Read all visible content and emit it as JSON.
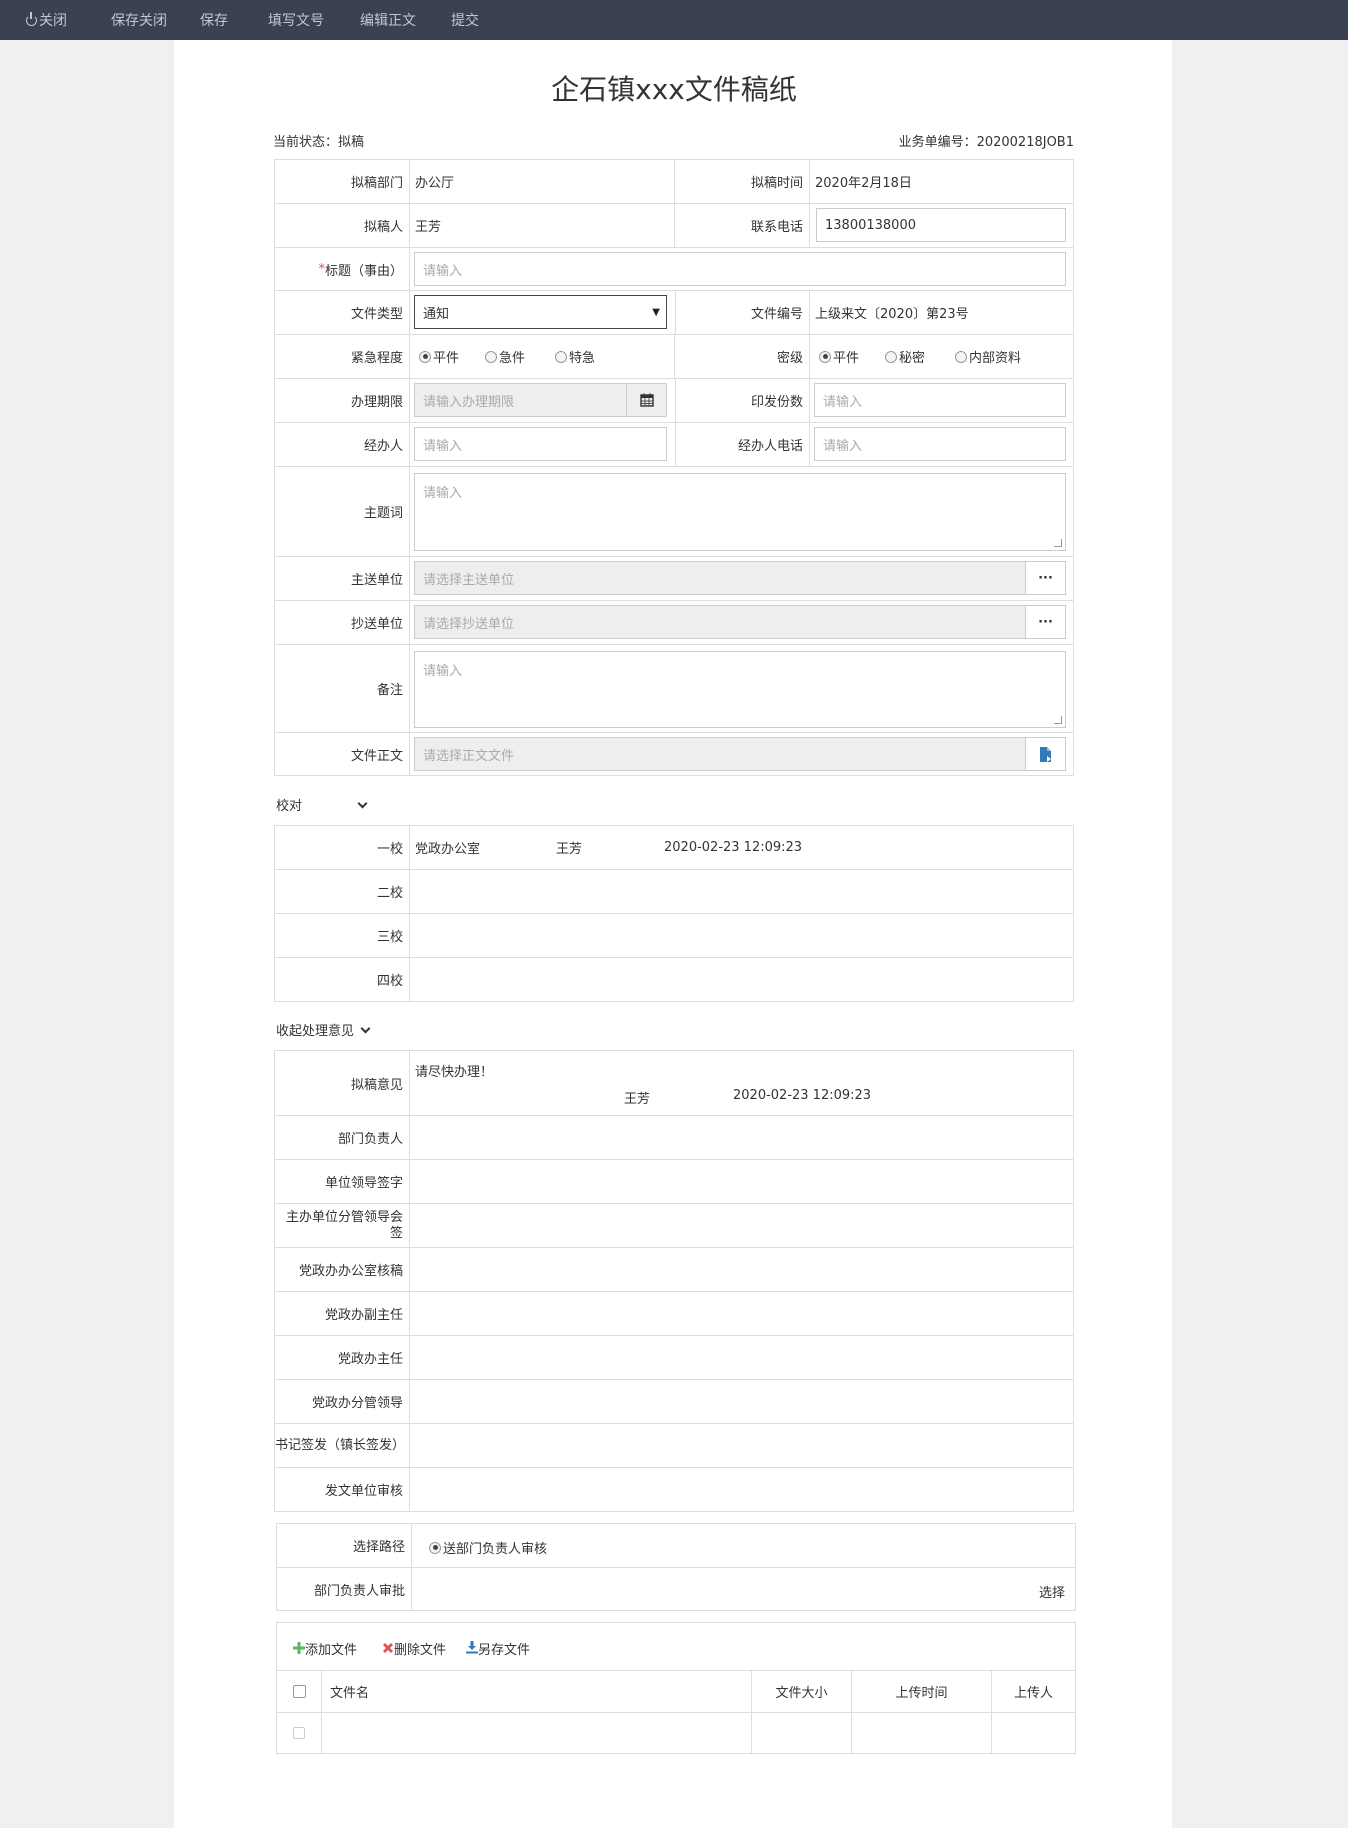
{
  "toolbar": {
    "close": "关闭",
    "save_close": "保存关闭",
    "save": "保存",
    "fill_number": "填写文号",
    "edit_body": "编辑正文",
    "submit": "提交"
  },
  "page": {
    "title": "企石镇xxx文件稿纸",
    "status": "当前状态：拟稿",
    "biz_no": "业务单编号：20200218JOB1"
  },
  "form": {
    "dept_label": "拟稿部门",
    "dept_value": "办公厅",
    "time_label": "拟稿时间",
    "time_value": "2020年2月18日",
    "author_label": "拟稿人",
    "author_value": "王芳",
    "phone_label": "联系电话",
    "phone_value": "13800138000",
    "title_req": "*",
    "title_label": "标题（事由）",
    "title_placeholder": "请输入",
    "type_label": "文件类型",
    "type_value": "通知",
    "docno_label": "文件编号",
    "docno_value": "上级来文〔2020〕第23号",
    "urgency_label": "紧急程度",
    "urgency_options": [
      "平件",
      "急件",
      "特急"
    ],
    "secret_label": "密级",
    "secret_options": [
      "平件",
      "秘密",
      "内部资料"
    ],
    "deadline_label": "办理期限",
    "deadline_placeholder": "请输入办理期限",
    "copies_label": "印发份数",
    "copies_placeholder": "请输入",
    "handler_label": "经办人",
    "handler_placeholder": "请输入",
    "handler_phone_label": "经办人电话",
    "handler_phone_placeholder": "请输入",
    "keywords_label": "主题词",
    "keywords_placeholder": "请输入",
    "main_unit_label": "主送单位",
    "main_unit_placeholder": "请选择主送单位",
    "cc_unit_label": "抄送单位",
    "cc_unit_placeholder": "请选择抄送单位",
    "remark_label": "备注",
    "remark_placeholder": "请输入",
    "body_label": "文件正文",
    "body_placeholder": "请选择正文文件",
    "ellipsis": "···"
  },
  "proof": {
    "section": "校对",
    "rows": [
      {
        "label": "一校",
        "unit": "党政办公室",
        "person": "王芳",
        "time": "2020-02-23 12:09:23"
      },
      {
        "label": "二校"
      },
      {
        "label": "三校"
      },
      {
        "label": "四校"
      }
    ]
  },
  "opinion": {
    "section": "收起处理意见",
    "draft_label": "拟稿意见",
    "draft_text": "请尽快办理！",
    "draft_person": "王芳",
    "draft_time": "2020-02-23 12:09:23",
    "rows": [
      "部门负责人",
      "单位领导签字",
      "主办单位分管领导会签",
      "党政办办公室核稿",
      "党政办副主任",
      "党政办主任",
      "党政办分管领导",
      "书记签发（镇长签发）",
      "发文单位审核"
    ]
  },
  "route": {
    "path_label": "选择路径",
    "path_option": "送部门负责人审核",
    "approver_label": "部门负责人审批",
    "select": "选择"
  },
  "files": {
    "add": "添加文件",
    "delete": "删除文件",
    "save_as": "另存文件",
    "columns": [
      "文件名",
      "文件大小",
      "上传时间",
      "上传人"
    ]
  },
  "colors": {
    "topbar": "#3a4150",
    "add_icon": "#5cb85c",
    "delete_icon": "#d9534f",
    "save_icon": "#337ab7"
  }
}
